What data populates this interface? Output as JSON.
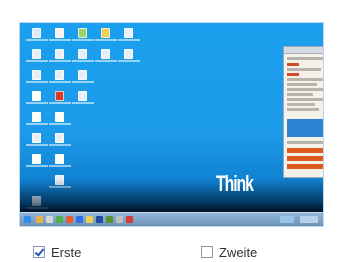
{
  "preview": {
    "brand_text": "Think",
    "colors": {
      "desktop": "#1c9ae9",
      "taskbar": "#7fa6c8"
    },
    "desktop_icons": [
      {
        "name": "computer-icon",
        "col": 0,
        "row": 0
      },
      {
        "name": "docs-icon",
        "col": 1,
        "row": 0
      },
      {
        "name": "network-icon",
        "col": 2,
        "row": 0
      },
      {
        "name": "folder-icon",
        "col": 3,
        "row": 0
      },
      {
        "name": "recycle-icon",
        "col": 4,
        "row": 0
      },
      {
        "name": "app-icon",
        "col": 0,
        "row": 1
      },
      {
        "name": "app-icon",
        "col": 1,
        "row": 1
      },
      {
        "name": "app-icon",
        "col": 2,
        "row": 1
      },
      {
        "name": "app-icon",
        "col": 3,
        "row": 1
      },
      {
        "name": "app-icon",
        "col": 4,
        "row": 1
      },
      {
        "name": "app-icon",
        "col": 0,
        "row": 2
      },
      {
        "name": "app-icon",
        "col": 1,
        "row": 2
      },
      {
        "name": "app-icon",
        "col": 2,
        "row": 2
      },
      {
        "name": "file-icon",
        "col": 0,
        "row": 3
      },
      {
        "name": "pdf-icon",
        "col": 1,
        "row": 3
      },
      {
        "name": "app-icon",
        "col": 2,
        "row": 3
      },
      {
        "name": "file-icon",
        "col": 0,
        "row": 4
      },
      {
        "name": "file-icon",
        "col": 1,
        "row": 4
      },
      {
        "name": "app-icon",
        "col": 0,
        "row": 5
      },
      {
        "name": "app-icon",
        "col": 1,
        "row": 5
      },
      {
        "name": "file-icon",
        "col": 0,
        "row": 6
      },
      {
        "name": "file-icon",
        "col": 1,
        "row": 6
      },
      {
        "name": "app-icon",
        "col": 1,
        "row": 7
      },
      {
        "name": "file-icon",
        "col": 0,
        "row": 8
      }
    ]
  },
  "options": [
    {
      "label": "Erste",
      "checked": true
    },
    {
      "label": "Zweite",
      "checked": false
    }
  ]
}
